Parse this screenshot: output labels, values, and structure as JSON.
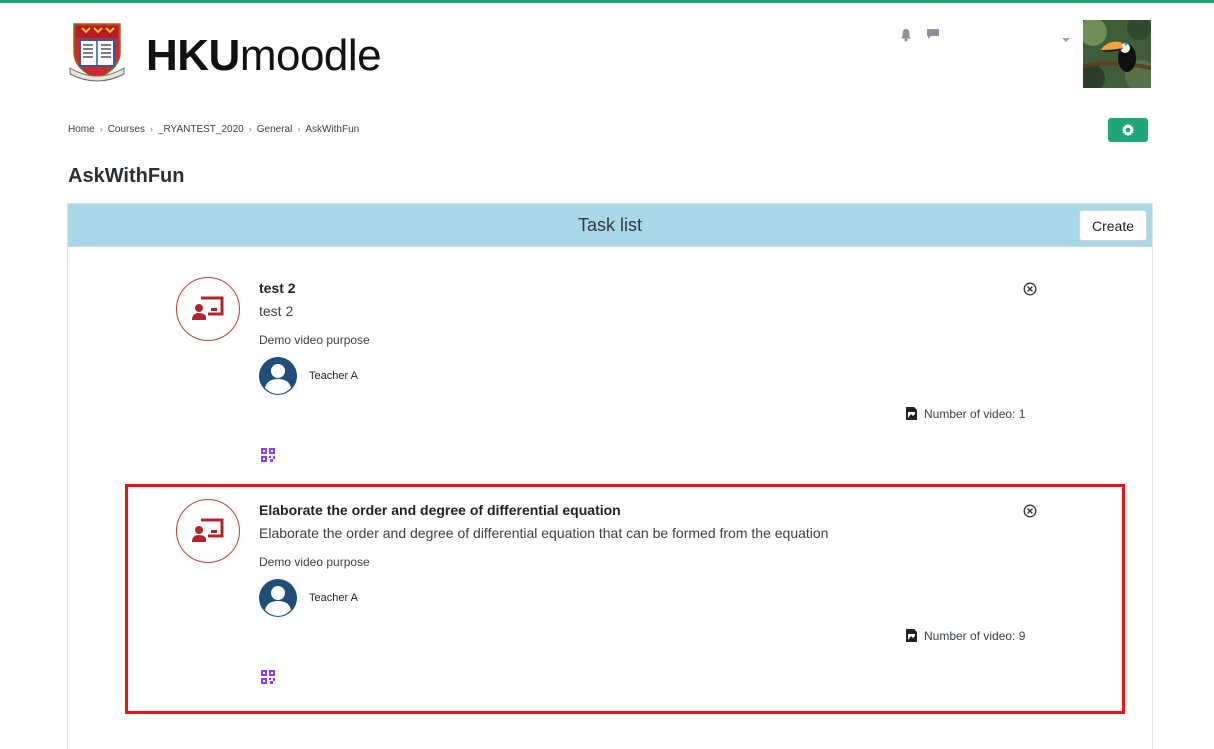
{
  "header": {
    "brand_bold": "HKU",
    "brand_rest": "moodle"
  },
  "breadcrumb": [
    "Home",
    "Courses",
    "_RYANTEST_2020",
    "General",
    "AskWithFun"
  ],
  "page_title": "AskWithFun",
  "panel": {
    "title": "Task list",
    "create_label": "Create"
  },
  "tasks": [
    {
      "title": "test 2",
      "description": "test 2",
      "note": "Demo video purpose",
      "teacher": "Teacher A",
      "video_count": "Number of video: 1"
    },
    {
      "title": "Elaborate the order and degree of differential equation",
      "description": "Elaborate the order and degree of differential equation that can be formed from the equation",
      "note": "Demo video purpose",
      "teacher": "Teacher A",
      "video_count": "Number of video: 9"
    }
  ],
  "colors": {
    "accent": "#1fa67a",
    "header_bar": "#a8d8e8",
    "task_icon": "#b3232a",
    "qr_icon": "#8a3ffc",
    "highlight": "#e8141a"
  },
  "icons": {
    "notification": "bell-icon",
    "messages": "chat-icon",
    "settings": "gear-icon",
    "task": "presentation-icon",
    "delete": "close-circle-icon",
    "video": "video-file-icon",
    "qr": "qr-code-icon"
  }
}
